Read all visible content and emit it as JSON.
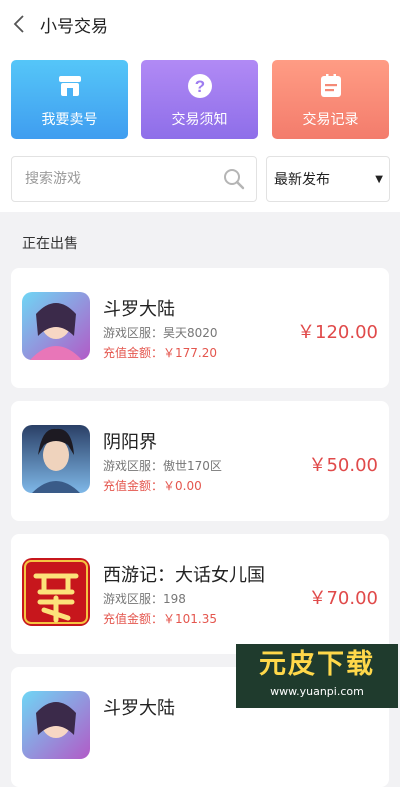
{
  "header": {
    "title": "小号交易"
  },
  "actions": [
    {
      "label": "我要卖号",
      "icon": "shop-icon"
    },
    {
      "label": "交易须知",
      "icon": "question-icon"
    },
    {
      "label": "交易记录",
      "icon": "record-icon"
    }
  ],
  "search": {
    "placeholder": "搜索游戏",
    "sort_value": "最新发布"
  },
  "section_title": "正在出售",
  "listings": [
    {
      "name": "斗罗大陆",
      "server": "游戏区服：昊天8020",
      "recharge": "充值金额：￥177.20",
      "price": "￥120.00"
    },
    {
      "name": "阴阳界",
      "server": "游戏区服：傲世170区",
      "recharge": "充值金额：￥0.00",
      "price": "￥50.00"
    },
    {
      "name": "西游记：大话女儿国",
      "server": "游戏区服：198",
      "recharge": "充值金额：￥101.35",
      "price": "￥70.00"
    },
    {
      "name": "斗罗大陆"
    }
  ],
  "watermark": {
    "title": "元皮下载",
    "url": "www.yuanpi.com"
  },
  "colors": {
    "price": "#e04a4a",
    "recharge": "#e4564e",
    "sell": "#4ab2f5",
    "notice": "#9d7cf0",
    "records": "#f48a77"
  }
}
